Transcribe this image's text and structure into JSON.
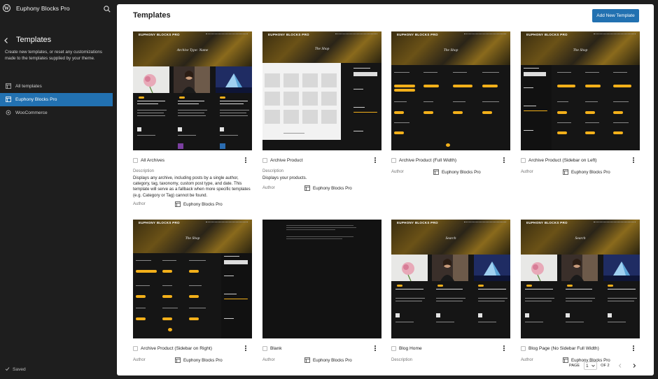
{
  "sidebar": {
    "site_title": "Euphony Blocks Pro",
    "heading": "Templates",
    "description": "Create new templates, or reset any customizations made to the templates supplied by your theme.",
    "items": [
      {
        "label": "All templates",
        "icon": "layout-icon",
        "active": false
      },
      {
        "label": "Euphony Blocks Pro",
        "icon": "layout-icon",
        "active": true
      },
      {
        "label": "WooCommerce",
        "icon": "plugin-icon",
        "active": false
      }
    ],
    "status": "Saved"
  },
  "main": {
    "title": "Templates",
    "add_button": "Add New Template"
  },
  "labels": {
    "description": "Description",
    "author": "Author"
  },
  "templates": [
    {
      "name": "All Archives",
      "description": "Displays any archive, including posts by a single author, category, tag, taxonomy, custom post type, and date. This template will serve as a fallback when more specific templates (e.g. Category or Tag) cannot be found.",
      "author": "Euphony Blocks Pro",
      "thumb_heading": "Archive Type: Name"
    },
    {
      "name": "Archive Product",
      "description": "Displays your products.",
      "author": "Euphony Blocks Pro",
      "thumb_heading": "The Shop"
    },
    {
      "name": "Archive Product (Full Width)",
      "description": "",
      "author": "Euphony Blocks Pro",
      "thumb_heading": "The Shop"
    },
    {
      "name": "Archive Product (Sidebar on Left)",
      "description": "",
      "author": "Euphony Blocks Pro",
      "thumb_heading": "The Shop"
    },
    {
      "name": "Archive Product (Sidebar on Right)",
      "description": "",
      "author": "Euphony Blocks Pro",
      "thumb_heading": "The Shop"
    },
    {
      "name": "Blank",
      "description": "",
      "author": "Euphony Blocks Pro",
      "thumb_heading": ""
    },
    {
      "name": "Blog Home",
      "description": "",
      "author": "",
      "thumb_heading": "Search"
    },
    {
      "name": "Blog Page (No Sidebar Full Width)",
      "description": "",
      "author": "Euphony Blocks Pro",
      "thumb_heading": "Search"
    }
  ],
  "thumb_brand": "EUPHONY BLOCKS PRO",
  "pagination": {
    "label": "PAGE",
    "current": "1",
    "of": "OF 2"
  },
  "colors": {
    "accent": "#2271b1",
    "sidebar_bg": "#1e1e1e",
    "thumb_yellow": "#f3b01a"
  }
}
